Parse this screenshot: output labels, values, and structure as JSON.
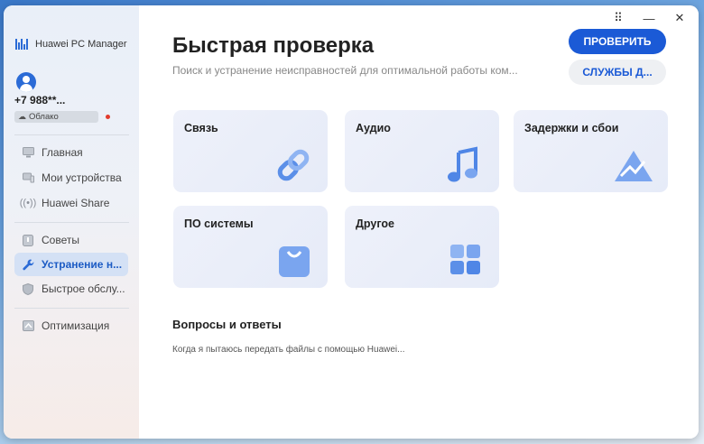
{
  "app": {
    "name": "Huawei PC Manager"
  },
  "account": {
    "phone": "+7 988**...",
    "cloud_label": "Облако"
  },
  "sidebar": {
    "items": [
      {
        "label": "Главная",
        "icon": "monitor-icon"
      },
      {
        "label": "Мои устройства",
        "icon": "devices-icon"
      },
      {
        "label": "Huawei Share",
        "icon": "share-icon"
      },
      {
        "label": "Советы",
        "icon": "tips-icon"
      },
      {
        "label": "Устранение н...",
        "icon": "wrench-icon",
        "active": true
      },
      {
        "label": "Быстрое обслу...",
        "icon": "shield-icon"
      },
      {
        "label": "Оптимизация",
        "icon": "optimize-icon"
      }
    ]
  },
  "window_controls": {
    "pin": "⠿",
    "minimize": "—",
    "close": "✕"
  },
  "main": {
    "title": "Быстрая проверка",
    "subtitle": "Поиск и устранение неисправностей для оптимальной работы ком...",
    "check_button": "ПРОВЕРИТЬ",
    "services_button": "СЛУЖБЫ Д...",
    "cards": [
      {
        "label": "Связь",
        "icon": "link-icon"
      },
      {
        "label": "Аудио",
        "icon": "music-note-icon"
      },
      {
        "label": "Задержки и сбои",
        "icon": "warning-triangle-icon"
      },
      {
        "label": "ПО системы",
        "icon": "system-bag-icon"
      },
      {
        "label": "Другое",
        "icon": "grid-apps-icon"
      }
    ],
    "faq": {
      "title": "Вопросы и ответы",
      "items": [
        "Когда я пытаюсь передать файлы с помощью Huawei..."
      ]
    }
  },
  "colors": {
    "accent": "#1b5ad6",
    "active_nav_bg": "#d4e1f5",
    "card_bg": "#e8ecf8",
    "icon_blue": "#5b8fe8"
  }
}
